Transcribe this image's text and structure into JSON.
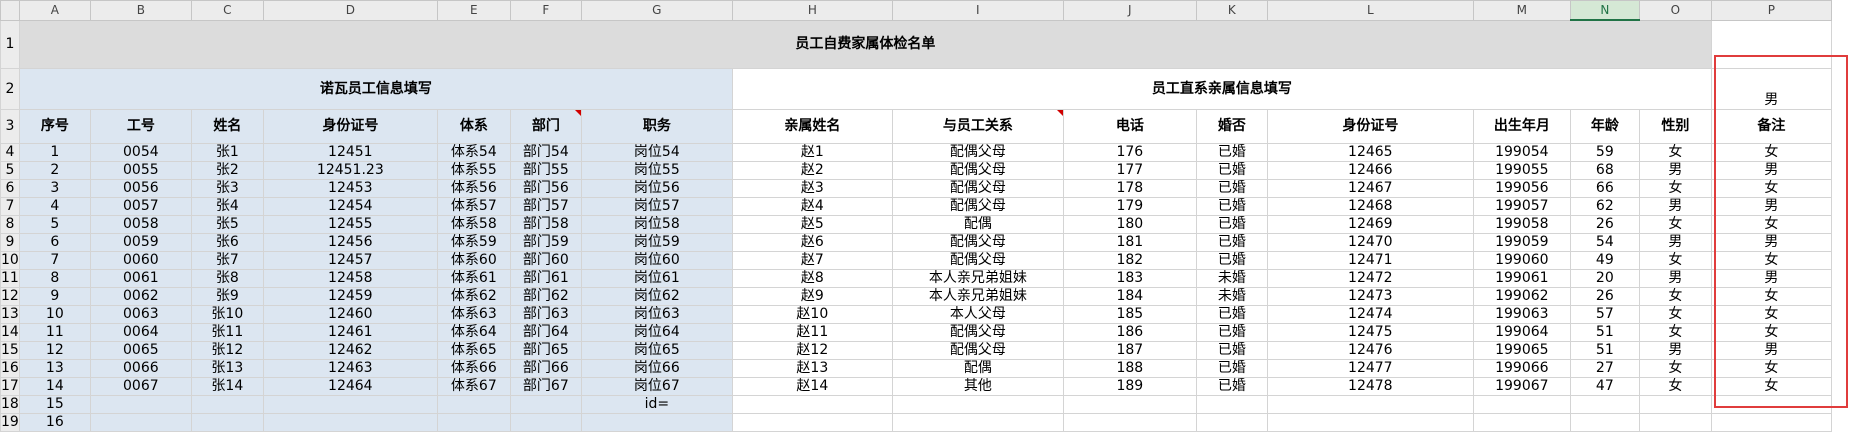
{
  "columns": [
    "A",
    "B",
    "C",
    "D",
    "E",
    "F",
    "G",
    "H",
    "I",
    "J",
    "K",
    "L",
    "M",
    "N",
    "O",
    "P"
  ],
  "selected_column": "N",
  "title": "员工自费家属体检名单",
  "group_left": "诺瓦员工信息填写",
  "group_right": "员工直系亲属信息填写",
  "row2_p": "男",
  "headers": [
    "序号",
    "工号",
    "姓名",
    "身份证号",
    "体系",
    "部门",
    "职务",
    "亲属姓名",
    "与员工关系",
    "电话",
    "婚否",
    "身份证号",
    "出生年月",
    "年龄",
    "性别",
    "备注"
  ],
  "rows": [
    [
      "1",
      "0054",
      "张1",
      "12451",
      "体系54",
      "部门54",
      "岗位54",
      "赵1",
      "配偶父母",
      "176",
      "已婚",
      "12465",
      "199054",
      "59",
      "女",
      "女"
    ],
    [
      "2",
      "0055",
      "张2",
      "12451.23",
      "体系55",
      "部门55",
      "岗位55",
      "赵2",
      "配偶父母",
      "177",
      "已婚",
      "12466",
      "199055",
      "68",
      "男",
      "男"
    ],
    [
      "3",
      "0056",
      "张3",
      "12453",
      "体系56",
      "部门56",
      "岗位56",
      "赵3",
      "配偶父母",
      "178",
      "已婚",
      "12467",
      "199056",
      "66",
      "女",
      "女"
    ],
    [
      "4",
      "0057",
      "张4",
      "12454",
      "体系57",
      "部门57",
      "岗位57",
      "赵4",
      "配偶父母",
      "179",
      "已婚",
      "12468",
      "199057",
      "62",
      "男",
      "男"
    ],
    [
      "5",
      "0058",
      "张5",
      "12455",
      "体系58",
      "部门58",
      "岗位58",
      "赵5",
      "配偶",
      "180",
      "已婚",
      "12469",
      "199058",
      "26",
      "女",
      "女"
    ],
    [
      "6",
      "0059",
      "张6",
      "12456",
      "体系59",
      "部门59",
      "岗位59",
      "赵6",
      "配偶父母",
      "181",
      "已婚",
      "12470",
      "199059",
      "54",
      "男",
      "男"
    ],
    [
      "7",
      "0060",
      "张7",
      "12457",
      "体系60",
      "部门60",
      "岗位60",
      "赵7",
      "配偶父母",
      "182",
      "已婚",
      "12471",
      "199060",
      "49",
      "女",
      "女"
    ],
    [
      "8",
      "0061",
      "张8",
      "12458",
      "体系61",
      "部门61",
      "岗位61",
      "赵8",
      "本人亲兄弟姐妹",
      "183",
      "未婚",
      "12472",
      "199061",
      "20",
      "男",
      "男"
    ],
    [
      "9",
      "0062",
      "张9",
      "12459",
      "体系62",
      "部门62",
      "岗位62",
      "赵9",
      "本人亲兄弟姐妹",
      "184",
      "未婚",
      "12473",
      "199062",
      "26",
      "女",
      "女"
    ],
    [
      "10",
      "0063",
      "张10",
      "12460",
      "体系63",
      "部门63",
      "岗位63",
      "赵10",
      "本人父母",
      "185",
      "已婚",
      "12474",
      "199063",
      "57",
      "女",
      "女"
    ],
    [
      "11",
      "0064",
      "张11",
      "12461",
      "体系64",
      "部门64",
      "岗位64",
      "赵11",
      "配偶父母",
      "186",
      "已婚",
      "12475",
      "199064",
      "51",
      "女",
      "女"
    ],
    [
      "12",
      "0065",
      "张12",
      "12462",
      "体系65",
      "部门65",
      "岗位65",
      "赵12",
      "配偶父母",
      "187",
      "已婚",
      "12476",
      "199065",
      "51",
      "男",
      "男"
    ],
    [
      "13",
      "0066",
      "张13",
      "12463",
      "体系66",
      "部门66",
      "岗位66",
      "赵13",
      "配偶",
      "188",
      "已婚",
      "12477",
      "199066",
      "27",
      "女",
      "女"
    ],
    [
      "14",
      "0067",
      "张14",
      "12464",
      "体系67",
      "部门67",
      "岗位67",
      "赵14",
      "其他",
      "189",
      "已婚",
      "12478",
      "199067",
      "47",
      "女",
      "女"
    ]
  ],
  "row15_seq": "15",
  "row15_job": "id=",
  "row16_seq": "16",
  "row_numbers": [
    "1",
    "2",
    "3",
    "4",
    "5",
    "6",
    "7",
    "8",
    "9",
    "10",
    "11",
    "12",
    "13",
    "14",
    "15",
    "16",
    "17",
    "18",
    "19"
  ],
  "colors": {
    "header_blue": "#dce6f1",
    "title_grey": "#dcdcdc",
    "highlight_red": "#e03c3c",
    "selected_col_green": "#217346"
  }
}
